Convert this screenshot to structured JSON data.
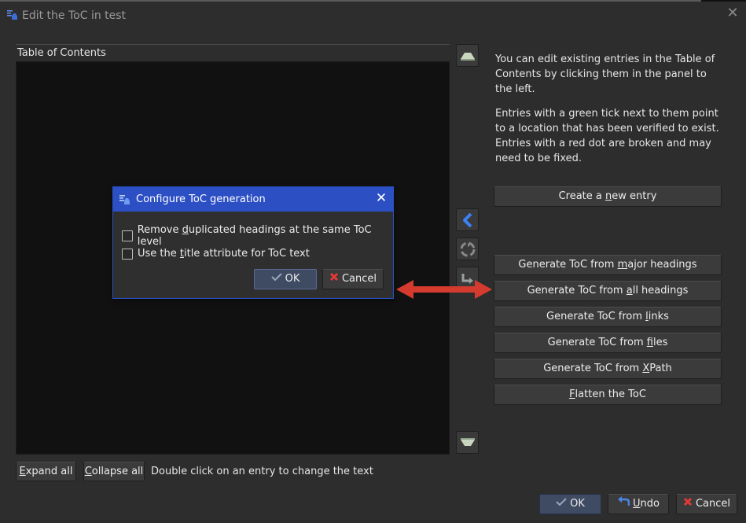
{
  "window": {
    "title": "Edit the ToC in test",
    "close_glyph": "✕"
  },
  "toc": {
    "header": "Table of Contents"
  },
  "help": {
    "para1": "You can edit existing entries in the Table of Contents by clicking them in the panel to the left.",
    "para2": "Entries with a green tick next to them point to a location that has been verified to exist. Entries with a red dot are broken and may need to be fixed."
  },
  "actions": {
    "create": {
      "pre": "Create a ",
      "key": "n",
      "post": "ew entry"
    },
    "major": {
      "pre": "Generate ToC from ",
      "key": "m",
      "post": "ajor headings"
    },
    "all": {
      "pre": "Generate ToC from ",
      "key": "a",
      "post": "ll headings"
    },
    "links": {
      "pre": "Generate ToC from ",
      "key": "l",
      "post": "inks"
    },
    "files": {
      "pre": "Generate ToC from ",
      "key": "f",
      "post": "iles"
    },
    "xpath": {
      "pre": "Generate ToC from ",
      "key": "X",
      "post": "Path"
    },
    "flatten": {
      "pre": "",
      "key": "F",
      "post": "latten the ToC"
    }
  },
  "bottom": {
    "expand": {
      "key": "E",
      "post": "xpand all"
    },
    "collapse": {
      "key": "C",
      "post": "ollapse all"
    },
    "hint": "Double click on an entry to change the text"
  },
  "dialog_buttons": {
    "ok": "OK",
    "undo": {
      "key": "U",
      "post": "ndo"
    },
    "cancel": "Cancel"
  },
  "modal": {
    "title": "Configure ToC generation",
    "close_glyph": "✕",
    "option1": {
      "pre": "Remove ",
      "key": "d",
      "post": "uplicated headings at the same ToC level",
      "checked": false
    },
    "option2": {
      "pre": "Use the ",
      "key": "t",
      "post": "itle attribute for ToC text",
      "checked": false
    },
    "ok": "OK",
    "cancel": "Cancel"
  },
  "icons": {
    "app": "toc-app-icon",
    "move_up": "move-up-icon",
    "indent_left": "chevron-left-icon",
    "delete": "recycle-icon",
    "indent_right": "arrow-right-icon",
    "move_down": "move-down-icon",
    "ok_check": "check-icon",
    "cancel_x": "red-x-icon",
    "undo": "undo-icon",
    "annotation_arrow": "double-arrow-icon"
  },
  "colors": {
    "accent_blue": "#2c4fc4",
    "annotation_red": "#d43b2e",
    "cancel_red": "#e53935",
    "panel_black": "#111111"
  }
}
